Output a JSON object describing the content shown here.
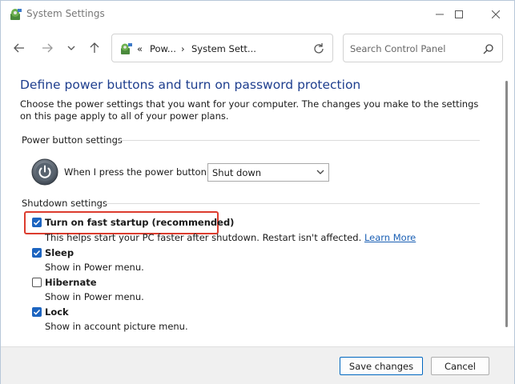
{
  "window": {
    "title": "System Settings",
    "app_icon": "control-panel-icon"
  },
  "navigation": {
    "breadcrumb_overflow": "«",
    "breadcrumb": [
      "Pow...",
      "System Sett..."
    ],
    "separator": "›",
    "search_placeholder": "Search Control Panel"
  },
  "page": {
    "heading": "Define power buttons and turn on password protection",
    "description": "Choose the power settings that you want for your computer. The changes you make to the settings on this page apply to all of your power plans."
  },
  "power_button_settings": {
    "title": "Power button settings",
    "label": "When I press the power button:",
    "selected": "Shut down"
  },
  "shutdown_settings": {
    "title": "Shutdown settings",
    "options": [
      {
        "label": "Turn on fast startup (recommended)",
        "description": "This helps start your PC faster after shutdown. Restart isn't affected.",
        "link": "Learn More",
        "checked": true,
        "highlighted": true
      },
      {
        "label": "Sleep",
        "description": "Show in Power menu.",
        "checked": true
      },
      {
        "label": "Hibernate",
        "description": "Show in Power menu.",
        "checked": false
      },
      {
        "label": "Lock",
        "description": "Show in account picture menu.",
        "checked": true
      }
    ]
  },
  "footer": {
    "save_label": "Save changes",
    "cancel_label": "Cancel"
  },
  "colors": {
    "heading": "#1e3e8e",
    "accent": "#1c64c0",
    "highlight": "#dc3c2e",
    "link": "#1a5fb4"
  }
}
